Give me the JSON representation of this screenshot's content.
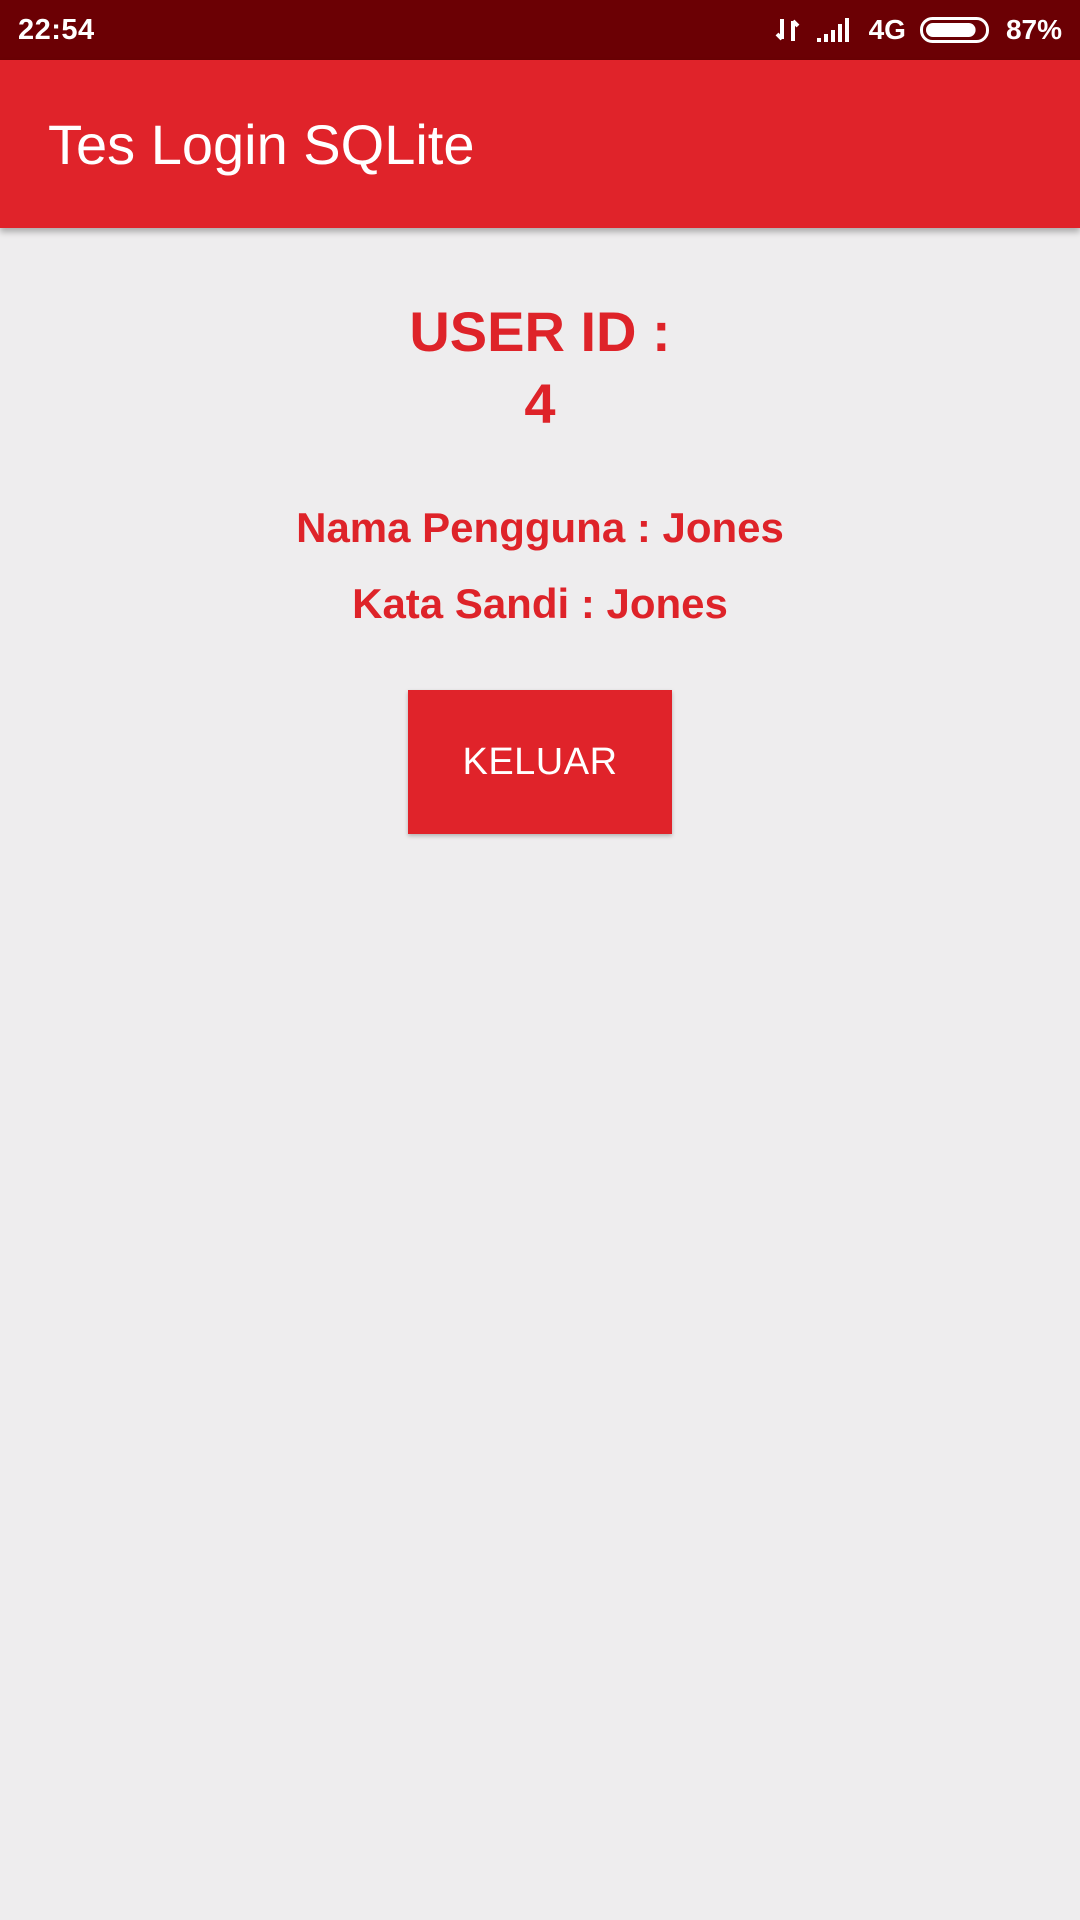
{
  "status_bar": {
    "time": "22:54",
    "network_type": "4G",
    "battery_percent": "87%",
    "battery_level": 0.87,
    "icons": [
      "data-transfer-icon",
      "signal-icon",
      "battery-icon"
    ]
  },
  "app_bar": {
    "title": "Tes Login SQLite"
  },
  "content": {
    "user_id_label": "USER ID :",
    "user_id_value": "4",
    "username_line": "Nama Pengguna : Jones",
    "password_line": "Kata Sandi : Jones",
    "logout_label": "KELUAR"
  },
  "colors": {
    "status_bar": "#6b0004",
    "primary": "#e0232a",
    "accent_text": "#de2329",
    "background": "#eeedee"
  }
}
